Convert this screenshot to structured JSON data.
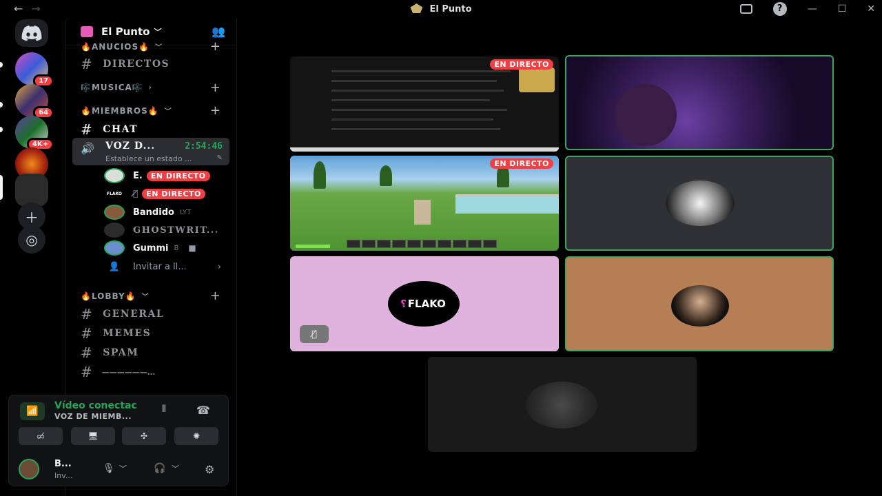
{
  "window": {
    "title": "El Punto",
    "back_icon": "arrow-left-icon",
    "forward_icon": "arrow-right-icon"
  },
  "servers": {
    "badges": [
      "17",
      "64",
      "4K+"
    ]
  },
  "guild": {
    "name": "El Punto"
  },
  "channels": {
    "cat_anuncios": "🔥ANUCIOS🔥",
    "directos": "DIRECTOS",
    "cat_musica": "🎼MUSICA🎼",
    "cat_miembros": "🔥MIEMBROS🔥",
    "chat": "CHAT",
    "voice": {
      "name": "VOZ D...",
      "timer": "2:54:46",
      "status": "Establece un estado ..."
    },
    "members": [
      {
        "name": "E.",
        "live": "EN DIRECTO"
      },
      {
        "name": "FLAKO",
        "live": "EN DIRECTO"
      },
      {
        "name": "Bandido",
        "extra": "LYT"
      },
      {
        "name": "GHOSTWRIT..."
      },
      {
        "name": "Gummi",
        "extra": "B"
      }
    ],
    "invite": "Invitar a ll...",
    "cat_lobby": "🔥LOBBY🔥",
    "general": "GENERAL",
    "memes": "MEMES",
    "spam": "SPAM",
    "divider_chan": "——————..."
  },
  "panel": {
    "connection_title": "Vídeo conectac",
    "connection_sub": "VOZ DE MIEMB...",
    "user_name": "B...",
    "user_status": "Inv..."
  },
  "stage": {
    "live_label": "EN DIRECTO",
    "flako_logo": "FLAKO"
  },
  "colors": {
    "accent_green": "#23a55a",
    "live_red": "#f23f43"
  }
}
